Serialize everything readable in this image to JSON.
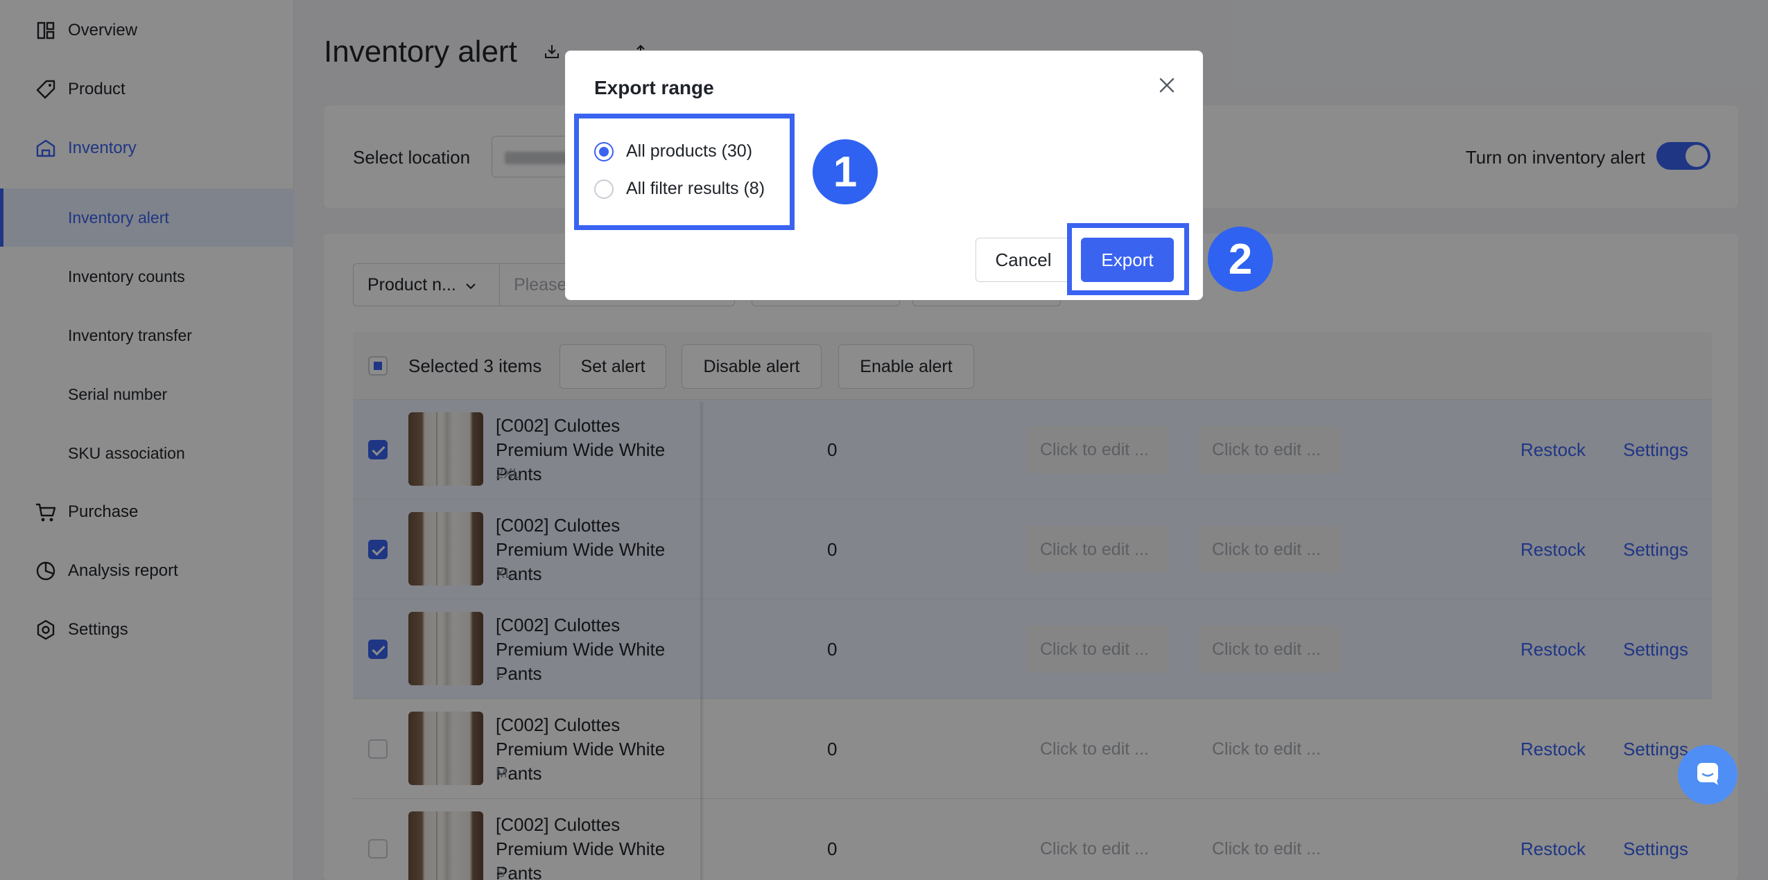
{
  "sidebar": {
    "items": [
      {
        "label": "Overview",
        "icon": "overview-icon"
      },
      {
        "label": "Product",
        "icon": "tag-icon"
      },
      {
        "label": "Inventory",
        "icon": "warehouse-icon"
      },
      {
        "label": "Purchase",
        "icon": "cart-icon"
      },
      {
        "label": "Analysis report",
        "icon": "pie-chart-icon"
      },
      {
        "label": "Settings",
        "icon": "hexagon-gear-icon"
      }
    ],
    "sub_items": [
      {
        "label": "Inventory alert"
      },
      {
        "label": "Inventory counts"
      },
      {
        "label": "Inventory transfer"
      },
      {
        "label": "Serial number"
      },
      {
        "label": "SKU association"
      }
    ]
  },
  "header": {
    "title": "Inventory alert"
  },
  "location": {
    "label": "Select location",
    "alert_toggle_label": "Turn on inventory alert",
    "alert_enabled": true
  },
  "filter": {
    "field": "Product n...",
    "placeholder": "Please"
  },
  "bulk": {
    "selected_text": "Selected 3 items",
    "set_alert": "Set alert",
    "disable_alert": "Disable alert",
    "enable_alert": "Enable alert"
  },
  "rows": [
    {
      "name": "[C002] Culottes Premium Wide White Pants",
      "variant": "2XL",
      "qty": "0",
      "edit1": "Click to edit ...",
      "edit2": "Click to edit ...",
      "restock": "Restock",
      "settings": "Settings",
      "checked": true
    },
    {
      "name": "[C002] Culottes Premium Wide White Pants",
      "variant": "XL",
      "qty": "0",
      "edit1": "Click to edit ...",
      "edit2": "Click to edit ...",
      "restock": "Restock",
      "settings": "Settings",
      "checked": true
    },
    {
      "name": "[C002] Culottes Premium Wide White Pants",
      "variant": "L",
      "qty": "0",
      "edit1": "Click to edit ...",
      "edit2": "Click to edit ...",
      "restock": "Restock",
      "settings": "Settings",
      "checked": true
    },
    {
      "name": "[C002] Culottes Premium Wide White Pants",
      "variant": "M",
      "qty": "0",
      "edit1": "Click to edit ...",
      "edit2": "Click to edit ...",
      "restock": "Restock",
      "settings": "Settings",
      "checked": false
    },
    {
      "name": "[C002] Culottes Premium Wide White Pants",
      "variant": "S",
      "qty": "0",
      "edit1": "Click to edit ...",
      "edit2": "Click to edit ...",
      "restock": "Restock",
      "settings": "Settings",
      "checked": false
    }
  ],
  "modal": {
    "title": "Export range",
    "options": [
      {
        "label": "All products (30)",
        "selected": true
      },
      {
        "label": "All filter results (8)",
        "selected": false
      }
    ],
    "cancel": "Cancel",
    "export": "Export"
  },
  "annotations": [
    {
      "number": "1"
    },
    {
      "number": "2"
    }
  ],
  "colors": {
    "accent": "#3a63f0",
    "annotation": "#2f62f0"
  }
}
